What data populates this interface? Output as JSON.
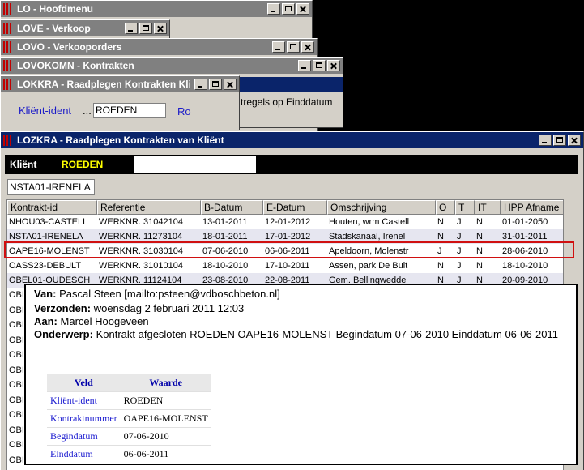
{
  "windows": {
    "lo": {
      "title": "LO - Hoofdmenu"
    },
    "love": {
      "title": "LOVE - Verkoop"
    },
    "lovo": {
      "title": "LOVO - Verkooporders"
    },
    "lovokomn": {
      "title": "LOVOKOMN - Kontrakten"
    },
    "lokkra": {
      "title": "LOKKRA - Raadplegen Kontrakten Kliënt",
      "label": "Kliënt-ident",
      "ellipsis": "...",
      "value": "ROEDEN",
      "trailing": "Ro",
      "partial_text": "tregels op Einddatum"
    },
    "lozkra": {
      "title": "LOZKRA - Raadplegen Kontrakten van Kliënt",
      "client_label": "Kliënt",
      "client_value": "ROEDEN",
      "selector_value": "NSTA01-IRENELA"
    }
  },
  "grid": {
    "columns": [
      "Kontrakt-id",
      "Referentie",
      "B-Datum",
      "E-Datum",
      "Omschrijving",
      "O",
      "T",
      "IT",
      "HPP Afname"
    ],
    "rows": [
      [
        "NHOU03-CASTELL",
        "WERKNR. 31042104",
        "13-01-2011",
        "12-01-2012",
        "Houten, wrm Castell",
        "N",
        "J",
        "N",
        "01-01-2050"
      ],
      [
        "NSTA01-IRENELA",
        "WERKNR. 11273104",
        "18-01-2011",
        "17-01-2012",
        "Stadskanaal, Irenel",
        "N",
        "J",
        "N",
        "31-01-2011"
      ],
      [
        "OAPE16-MOLENST",
        "WERKNR. 31030104",
        "07-06-2010",
        "06-06-2011",
        "Apeldoorn, Molenstr",
        "J",
        "J",
        "N",
        "28-06-2010"
      ],
      [
        "OASS23-DEBULT",
        "WERKNR. 31010104",
        "18-10-2010",
        "17-10-2011",
        "Assen, park De Bult",
        "N",
        "J",
        "N",
        "18-10-2010"
      ],
      [
        "OBEL01-OUDESCH",
        "WERKNR. 11124104",
        "23-08-2010",
        "22-08-2011",
        "Gem. Bellingwedde",
        "N",
        "J",
        "N",
        "20-09-2010"
      ]
    ],
    "obscured_prefix": "OBI"
  },
  "email": {
    "from_label": "Van:",
    "from_value": "Pascal Steen [mailto:psteen@vdboschbeton.nl]",
    "sent_label": "Verzonden:",
    "sent_value": "woensdag 2 februari 2011 12:03",
    "to_label": "Aan:",
    "to_value": "Marcel Hoogeveen",
    "subject_label": "Onderwerp:",
    "subject_value": "Kontrakt afgesloten ROEDEN OAPE16-MOLENST Begindatum 07-06-2010 Einddatum 06-06-2011",
    "table": {
      "headers": [
        "Veld",
        "Waarde"
      ],
      "rows": [
        [
          "Kliënt-ident",
          "ROEDEN"
        ],
        [
          "Kontraktnummer",
          "OAPE16-MOLENST"
        ],
        [
          "Begindatum",
          "07-06-2010"
        ],
        [
          "Einddatum",
          "06-06-2011"
        ]
      ]
    }
  },
  "colors": {
    "title_active": "#0a246a",
    "title_inactive": "#808080",
    "highlight_outline": "#d01010",
    "client_value": "#ffff00"
  }
}
